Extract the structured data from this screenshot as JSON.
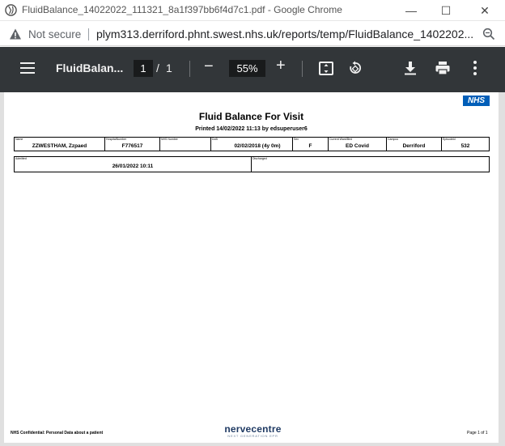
{
  "window": {
    "title": "FluidBalance_14022022_111321_8a1f397bb6f4d7c1.pdf - Google Chrome",
    "minimize_glyph": "—",
    "maximize_glyph": "☐",
    "close_glyph": "✕"
  },
  "address_bar": {
    "security_label": "Not secure",
    "url": "plym313.derriford.phnt.swest.nhs.uk/reports/temp/FluidBalance_1402202..."
  },
  "pdf_toolbar": {
    "doc_title": "FluidBalan...",
    "current_page": "1",
    "page_separator": "/",
    "total_pages": "1",
    "zoom_out_glyph": "−",
    "zoom": "55%",
    "zoom_in_glyph": "+"
  },
  "report": {
    "logo": "NHS",
    "title": "Fluid Balance For Visit",
    "printed": "Printed 14/02/2022 11:13 by edsuperuser6",
    "fields": [
      {
        "label": "Name",
        "value": "ZZWESTHAM, Zzpaed"
      },
      {
        "label": "HospitalNumber",
        "value": "F776517"
      },
      {
        "label": "NHS Number",
        "value": ""
      },
      {
        "label": "DoB",
        "value": "02/02/2018 (4y 0m)"
      },
      {
        "label": "Sex",
        "value": "F"
      },
      {
        "label": "Current Ward/Bed",
        "value": "ED Covid"
      },
      {
        "label": "Campus",
        "value": "Derriford"
      },
      {
        "label": "EpisodeId",
        "value": "532"
      }
    ],
    "admission": [
      {
        "label": "Admitted",
        "value": "26/01/2022 10:11"
      },
      {
        "label": "Discharged",
        "value": ""
      }
    ],
    "footer": {
      "confidential": "NHS Confidential: Personal Data about a patient",
      "brand": "nervecentre",
      "brand_tagline": "NEXT GENERATION EPR",
      "page": "Page 1 of 1"
    }
  }
}
